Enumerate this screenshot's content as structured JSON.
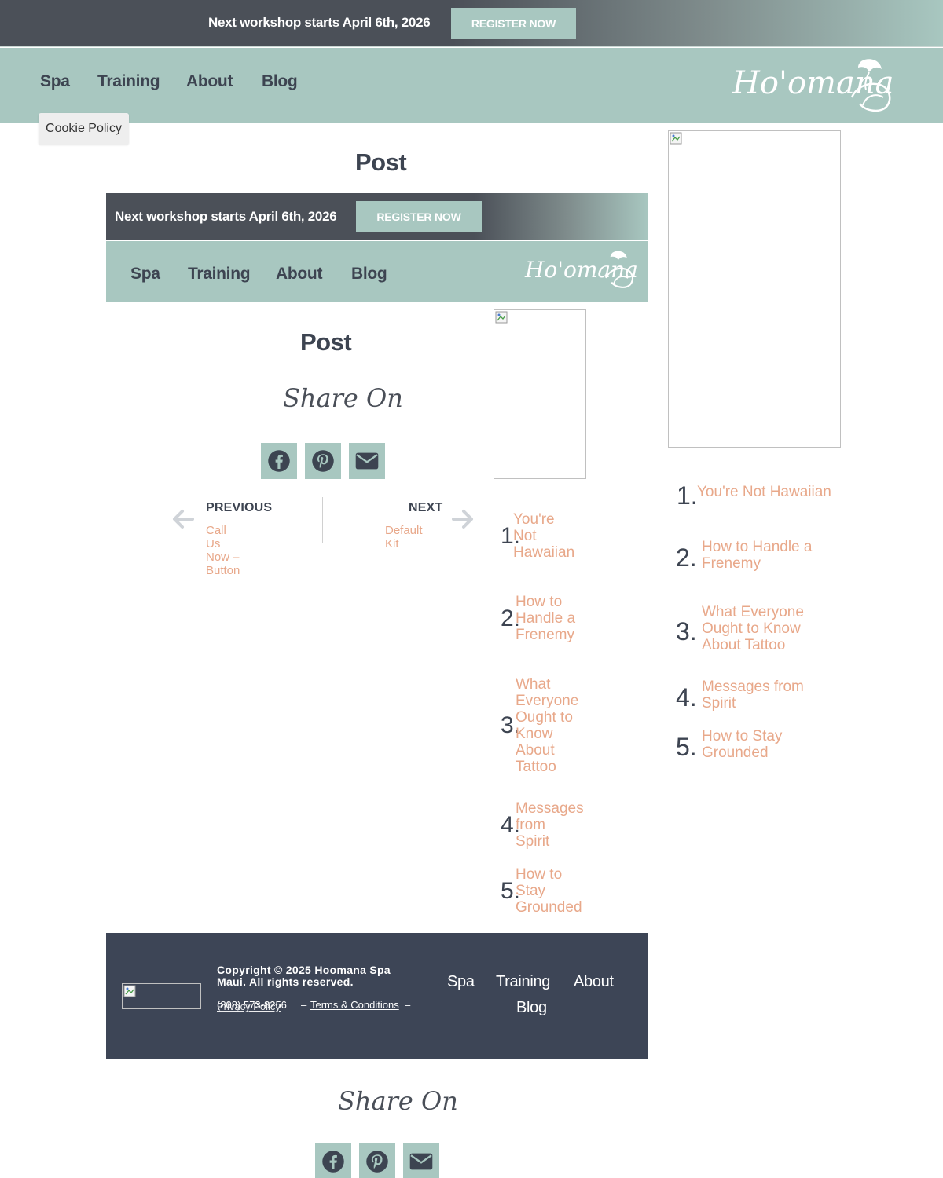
{
  "announcement": {
    "text": "Next workshop starts April 6th, 2026",
    "button": "REGISTER NOW"
  },
  "nav": {
    "items": [
      "Spa",
      "Training",
      "About",
      "Blog"
    ],
    "logo": "Ho'omana"
  },
  "cookie": {
    "label": "Cookie Policy"
  },
  "page": {
    "title": "Post"
  },
  "share": {
    "label": "Share On",
    "buttons": [
      "facebook-icon",
      "pinterest-icon",
      "envelope-icon"
    ]
  },
  "post_nav": {
    "previous_label": "PREVIOUS",
    "previous_title": "Call Us Now – Button",
    "next_label": "NEXT",
    "next_title": "Default Kit"
  },
  "popular": [
    {
      "num": "1.",
      "title": "You're Not Hawaiian"
    },
    {
      "num": "2.",
      "title": "How to Handle a Frenemy"
    },
    {
      "num": "3.",
      "title": "What Everyone Ought to Know About Tattoo"
    },
    {
      "num": "4.",
      "title": "Messages from Spirit"
    },
    {
      "num": "5.",
      "title": "How to Stay Grounded"
    }
  ],
  "footer": {
    "copyright": "Copyright © 2025 Hoomana Spa Maui. All rights reserved.",
    "phone": "(808) 573-8256",
    "privacy": "Privacy Policy",
    "terms": "Terms & Conditions",
    "separator": "–",
    "nav": [
      "Spa",
      "Training",
      "About",
      "Blog"
    ]
  },
  "colors": {
    "sage": "#a8c7c0",
    "charcoal": "#4b5058",
    "navy": "#3d4556",
    "link": "#e8a88a"
  }
}
